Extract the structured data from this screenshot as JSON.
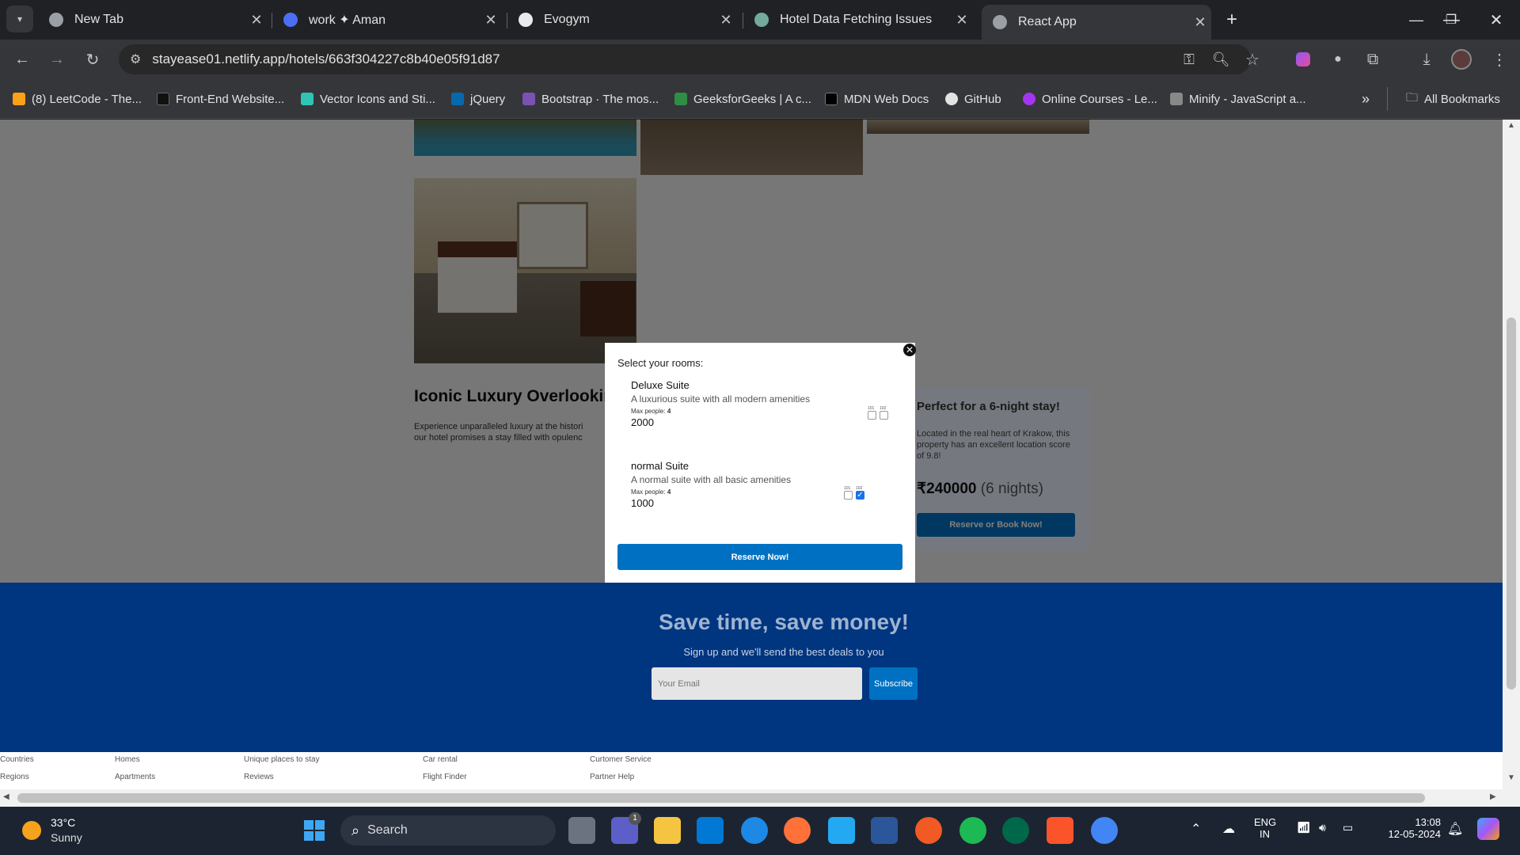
{
  "browser": {
    "tabs": [
      {
        "title": "New Tab"
      },
      {
        "title": "work ✦ Aman"
      },
      {
        "title": "Evogym"
      },
      {
        "title": "Hotel Data Fetching Issues"
      },
      {
        "title": "React App"
      }
    ],
    "url": "stayease01.netlify.app/hotels/663f304227c8b40e05f91d87",
    "bookmarks": [
      {
        "label": "(8) LeetCode - The..."
      },
      {
        "label": "Front-End Website..."
      },
      {
        "label": "Vector Icons and Sti..."
      },
      {
        "label": "jQuery"
      },
      {
        "label": "Bootstrap · The mos..."
      },
      {
        "label": "GeeksforGeeks | A c..."
      },
      {
        "label": "MDN Web Docs"
      },
      {
        "label": "GitHub"
      },
      {
        "label": "Online Courses - Le..."
      },
      {
        "label": "Minify - JavaScript a..."
      }
    ],
    "all_bookmarks": "All Bookmarks"
  },
  "hotel": {
    "title": "Iconic Luxury Overlookin",
    "description_line1": "Experience unparalleled luxury at the histori",
    "description_line2": "our hotel promises a stay filled with opulenc",
    "sidebar": {
      "heading": "Perfect for a 6-night stay!",
      "text": "Located in the real heart of Krakow, this property has an excellent location score of 9.8!",
      "price": "₹240000",
      "nights": "(6 nights)",
      "button": "Reserve or Book Now!"
    }
  },
  "modal": {
    "heading": "Select your rooms:",
    "rooms": [
      {
        "title": "Deluxe Suite",
        "desc": "A luxurious suite with all modern amenities",
        "max_label": "Max people:",
        "max": "4",
        "price": "2000",
        "numbers": [
          "101",
          "102"
        ],
        "checked": [
          false,
          false
        ]
      },
      {
        "title": "normal Suite",
        "desc": "A normal suite with all basic amenities",
        "max_label": "Max people:",
        "max": "4",
        "price": "1000",
        "numbers": [
          "101",
          "102"
        ],
        "checked": [
          false,
          true
        ]
      }
    ],
    "button": "Reserve Now!"
  },
  "newsletter": {
    "title": "Save time, save money!",
    "subtitle": "Sign up and we'll send the best deals to you",
    "placeholder": "Your Email",
    "button": "Subscribe"
  },
  "footer": {
    "columns": [
      [
        "Countries",
        "Regions"
      ],
      [
        "Homes",
        "Apartments"
      ],
      [
        "Unique places to stay",
        "Reviews"
      ],
      [
        "Car rental",
        "Flight Finder"
      ],
      [
        "Curtomer Service",
        "Partner Help"
      ]
    ]
  },
  "taskbar": {
    "weather_temp": "33°C",
    "weather_desc": "Sunny",
    "search": "Search",
    "lang1": "ENG",
    "lang2": "IN",
    "time": "13:08",
    "date": "12-05-2024",
    "teams_badge": "1"
  },
  "colors": {
    "brand": "#003580",
    "button": "#0071c2",
    "sidebar_bg": "#ebf3ff"
  }
}
